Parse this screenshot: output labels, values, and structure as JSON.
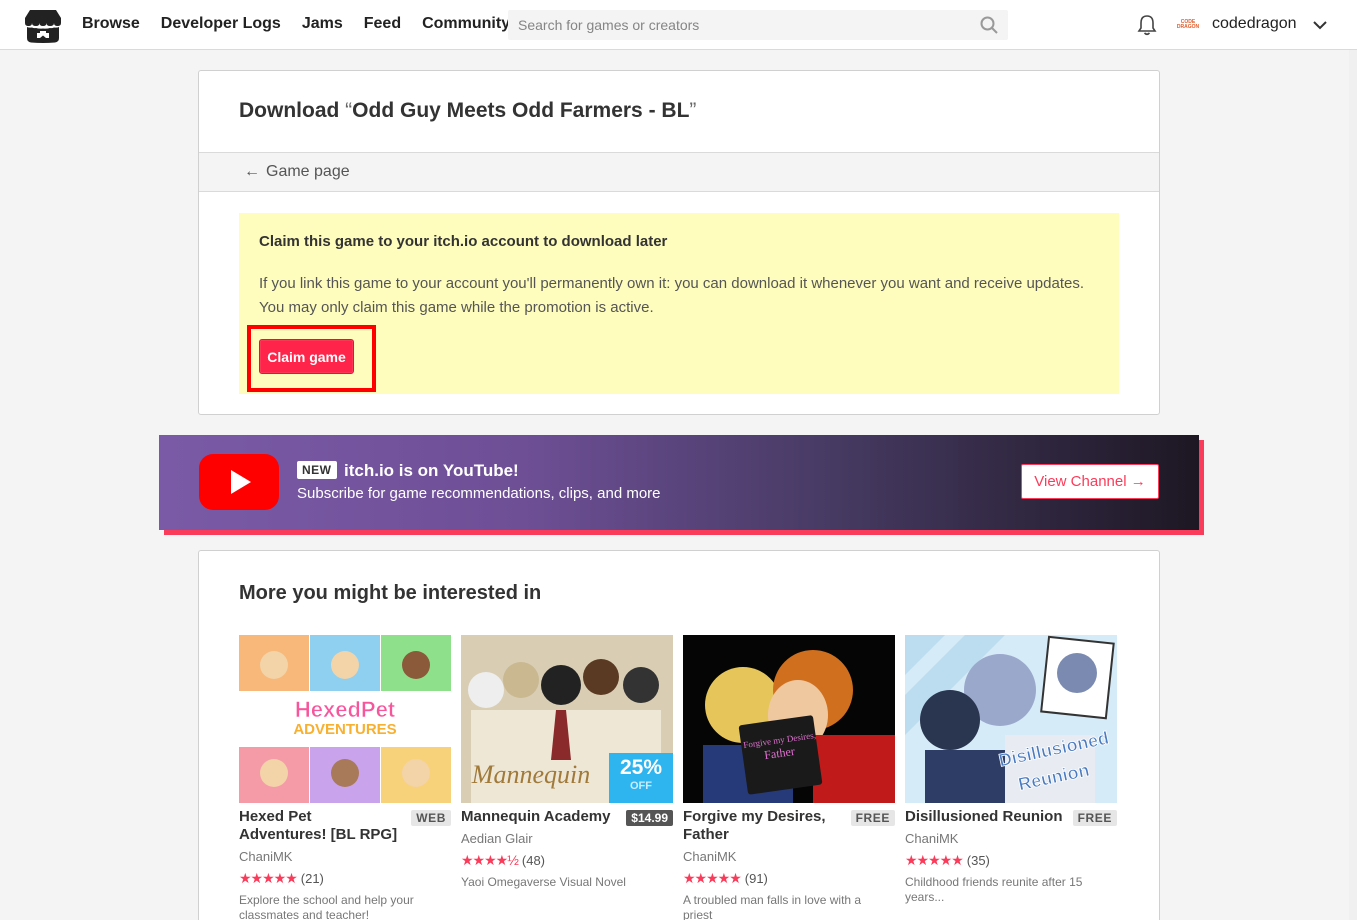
{
  "header": {
    "nav": [
      "Browse",
      "Developer Logs",
      "Jams",
      "Feed",
      "Community"
    ],
    "search_placeholder": "Search for games or creators",
    "avatar_text": [
      "CODE",
      "DRAGON"
    ],
    "username": "codedragon"
  },
  "download": {
    "title_prefix": "Download ",
    "open_quote": "“",
    "game_title": "Odd Guy Meets Odd Farmers - BL",
    "close_quote": "”",
    "back_label": "Game page",
    "claim_title": "Claim this game to your itch.io account to download later",
    "claim_desc": "If you link this game to your account you'll permanently own it: you can download it whenever you want and receive updates. You may only claim this game while the promotion is active.",
    "claim_button": "Claim game"
  },
  "youtube": {
    "badge": "NEW",
    "title": "itch.io is on YouTube!",
    "subtitle": "Subscribe for game recommendations, clips, and more",
    "button": "View Channel →"
  },
  "recommendations": {
    "title": "More you might be interested in",
    "games": [
      {
        "title": "Hexed Pet Adventures! [BL RPG]",
        "badge": "WEB",
        "author": "ChaniMK",
        "stars": "★★★★★",
        "count": "(21)",
        "desc": "Explore the school and help your classmates and teacher!",
        "thumb_text": "HexedPet ADVENTURES"
      },
      {
        "title": "Mannequin Academy",
        "badge": "$14.99",
        "author": "Aedian Glair",
        "stars": "★★★★½",
        "count": "(48)",
        "desc": "Yaoi Omegaverse Visual Novel",
        "sale_pct": "25%",
        "sale_off": "OFF",
        "thumb_text": "Mannequin Ac"
      },
      {
        "title": "Forgive my Desires, Father",
        "badge": "FREE",
        "author": "ChaniMK",
        "stars": "★★★★★",
        "count": "(91)",
        "desc": "A troubled man falls in love with a priest",
        "thumb_text": "Forgive my Desires, Father"
      },
      {
        "title": "Disillusioned Reunion",
        "badge": "FREE",
        "author": "ChaniMK",
        "stars": "★★★★★",
        "count": "(35)",
        "desc": "Childhood friends reunite after 15 years...",
        "thumb_text": "Disillusioned Reunion"
      }
    ]
  },
  "colors": {
    "accent": "#fa3c5a",
    "claim_button": "#ff2449",
    "claim_bg": "#fefdbd",
    "sale": "#2eb5f0"
  }
}
